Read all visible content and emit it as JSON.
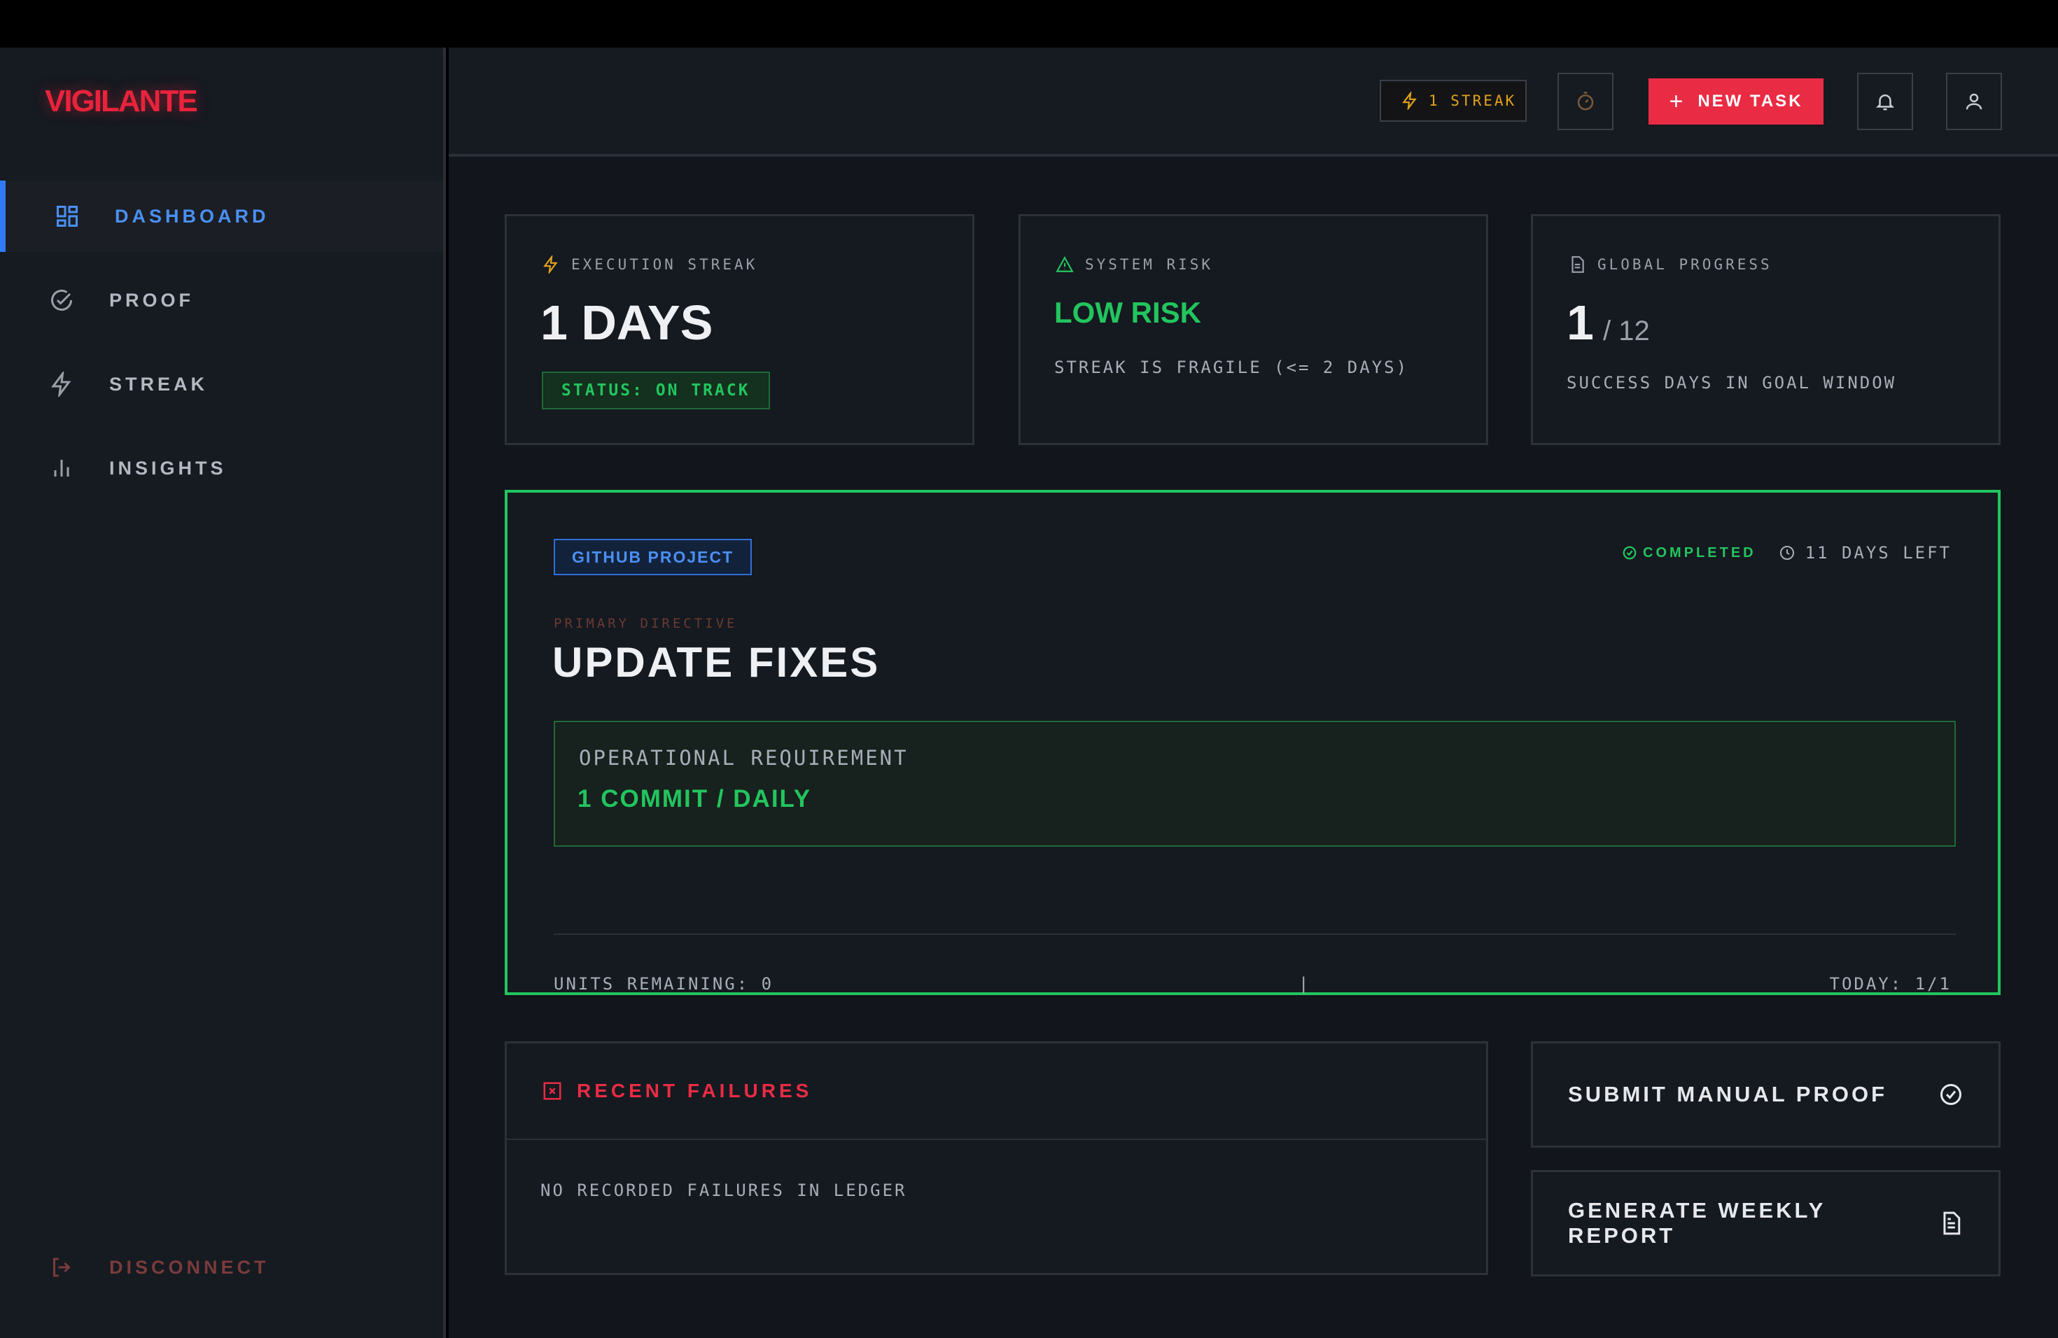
{
  "app": {
    "name": "VIGILANTE"
  },
  "sidebar": {
    "items": [
      {
        "label": "DASHBOARD",
        "icon": "dashboard-icon",
        "active": true
      },
      {
        "label": "PROOF",
        "icon": "check-circle-icon"
      },
      {
        "label": "STREAK",
        "icon": "lightning-icon"
      },
      {
        "label": "INSIGHTS",
        "icon": "bar-chart-icon"
      }
    ],
    "disconnect_label": "DISCONNECT"
  },
  "header": {
    "streak_label": "1 STREAK",
    "new_task_label": "NEW TASK"
  },
  "stats": {
    "execution_streak": {
      "label": "EXECUTION STREAK",
      "value": "1 DAYS",
      "status": "STATUS: ON TRACK"
    },
    "system_risk": {
      "label": "SYSTEM RISK",
      "value": "LOW RISK",
      "note": "STREAK IS FRAGILE (<= 2 DAYS)"
    },
    "global_progress": {
      "label": "GLOBAL PROGRESS",
      "value": "1",
      "total": "/ 12",
      "note": "SUCCESS DAYS IN GOAL WINDOW"
    }
  },
  "task": {
    "tag": "GITHUB PROJECT",
    "status": "COMPLETED",
    "days_left": "11 DAYS LEFT",
    "directive_label": "PRIMARY DIRECTIVE",
    "title": "UPDATE FIXES",
    "requirement_label": "OPERATIONAL REQUIREMENT",
    "requirement": "1 COMMIT / DAILY",
    "units_remaining": "UNITS REMAINING: 0",
    "separator": "|",
    "today": "TODAY: 1/1"
  },
  "failures": {
    "title": "RECENT FAILURES",
    "empty": "NO RECORDED FAILURES IN LEDGER"
  },
  "actions": {
    "submit_proof": "SUBMIT MANUAL PROOF",
    "weekly_report": "GENERATE WEEKLY REPORT"
  },
  "colors": {
    "accent_red": "#ea2b44",
    "accent_blue": "#4a90f5",
    "success_green": "#22c55e",
    "warning_amber": "#e2a21b"
  }
}
